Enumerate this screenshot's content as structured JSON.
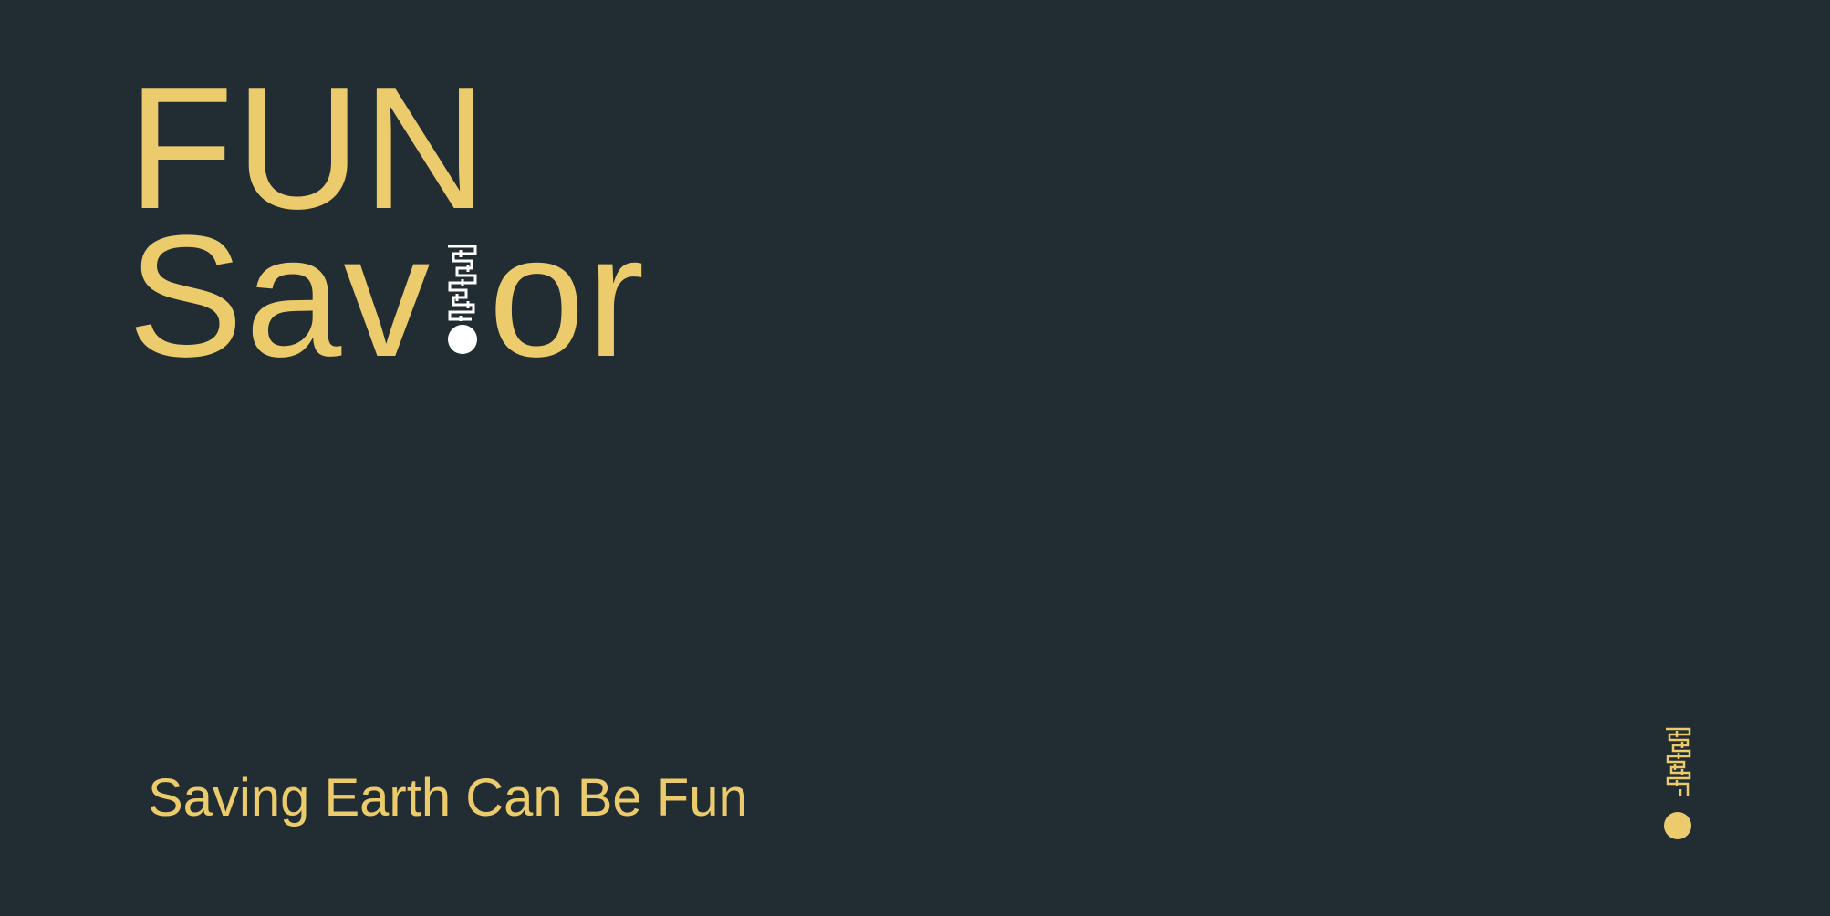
{
  "title": {
    "line1": "FUN",
    "line2_prefix": "Sav",
    "line2_suffix": "or",
    "i_replacement_icon": "maze-exclamation-icon"
  },
  "tagline": "Saving Earth Can Be Fun",
  "brand_mark_icon": "maze-exclamation-icon",
  "colors": {
    "background": "#212c33",
    "accent": "#ebcb6b",
    "logo_white": "#ffffff"
  }
}
